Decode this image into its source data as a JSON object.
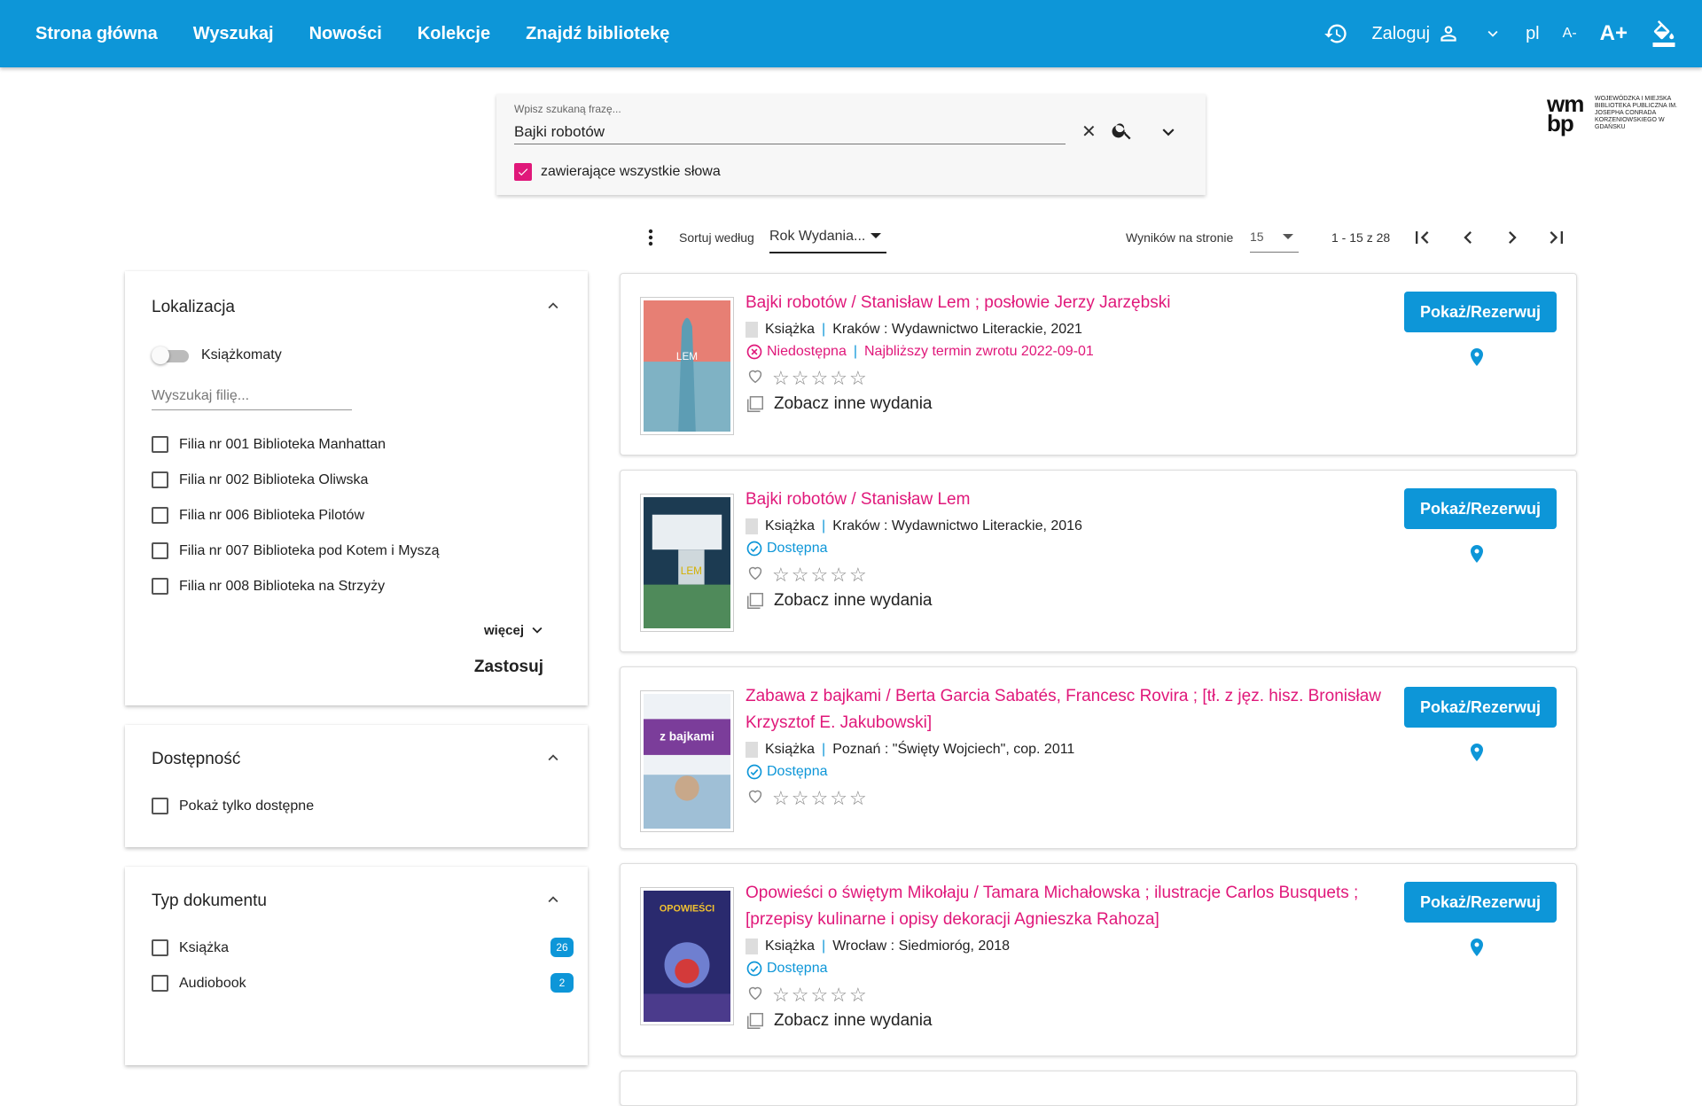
{
  "nav": {
    "items": [
      "Strona główna",
      "Wyszukaj",
      "Nowości",
      "Kolekcje",
      "Znajdź bibliotekę"
    ],
    "login": "Zaloguj",
    "lang": "pl",
    "font_smaller": "A-",
    "font_larger": "A+"
  },
  "search": {
    "placeholder": "Wpisz szukaną frazę...",
    "value": "Bajki robotów",
    "all_words_label": "zawierające wszystkie słowa"
  },
  "logo": {
    "mark_top": "wm",
    "mark_bottom": "bp",
    "text": "WOJEWÓDZKA I MIEJSKA BIBLIOTEKA PUBLICZNA IM. JOSEPHA CONRADA KORZENIOWSKIEGO W GDAŃSKU"
  },
  "sort": {
    "label": "Sortuj według",
    "value": "Rok Wydania...",
    "per_page_label": "Wyników na stronie",
    "per_page_value": "15",
    "range": "1 - 15 z 28"
  },
  "filters": {
    "location": {
      "title": "Lokalizacja",
      "toggle_label": "Książkomaty",
      "search_placeholder": "Wyszukaj filię...",
      "branches": [
        "Filia nr 001 Biblioteka Manhattan",
        "Filia nr 002 Biblioteka Oliwska",
        "Filia nr 006 Biblioteka Pilotów",
        "Filia nr 007 Biblioteka pod Kotem i Myszą",
        "Filia nr 008 Biblioteka na Strzyży"
      ],
      "more": "więcej",
      "apply": "Zastosuj"
    },
    "availability": {
      "title": "Dostępność",
      "option": "Pokaż tylko dostępne"
    },
    "doctype": {
      "title": "Typ dokumentu",
      "options": [
        {
          "label": "Książka",
          "count": "26"
        },
        {
          "label": "Audiobook",
          "count": "2"
        }
      ]
    }
  },
  "results": [
    {
      "title": "Bajki robotów / Stanisław Lem ; posłowie Jerzy Jarzębski",
      "type": "Książka",
      "publisher": "Kraków : Wydawnictwo Literackie, 2021",
      "status": "Niedostępna",
      "status_extra": "Najbliższy termin zwrotu 2022-09-01",
      "editions": "Zobacz inne wydania",
      "button": "Pokaż/Rezerwuj",
      "status_color": "#e0187a"
    },
    {
      "title": "Bajki robotów / Stanisław Lem",
      "type": "Książka",
      "publisher": "Kraków : Wydawnictwo Literackie, 2016",
      "status": "Dostępna",
      "editions": "Zobacz inne wydania",
      "button": "Pokaż/Rezerwuj",
      "status_color": "#0d96d8"
    },
    {
      "title": "Zabawa z bajkami / Berta Garcia Sabatés, Francesc Rovira ; [tł. z jęz. hisz. Bronisław Krzysztof E. Jakubowski]",
      "type": "Książka",
      "publisher": "Poznań : \"Święty Wojciech\", cop. 2011",
      "status": "Dostępna",
      "button": "Pokaż/Rezerwuj",
      "status_color": "#0d96d8"
    },
    {
      "title": "Opowieści o świętym Mikołaju / Tamara Michałowska ; ilustracje Carlos Busquets ; [przepisy kulinarne i opisy dekoracji Agnieszka Rahoza]",
      "type": "Książka",
      "publisher": "Wrocław : Siedmioróg, 2018",
      "status": "Dostępna",
      "editions": "Zobacz inne wydania",
      "button": "Pokaż/Rezerwuj",
      "status_color": "#0d96d8"
    }
  ],
  "icons": [
    "history-icon",
    "user-icon",
    "chevron-down-icon",
    "paint-bucket-icon",
    "search-icon",
    "close-icon",
    "kebab-icon",
    "first-page-icon",
    "prev-page-icon",
    "next-page-icon",
    "last-page-icon",
    "heart-icon",
    "star-icon",
    "pin-icon",
    "editions-icon",
    "book-icon"
  ],
  "colors": {
    "accent": "#0d96d8",
    "title": "#e0187a"
  }
}
